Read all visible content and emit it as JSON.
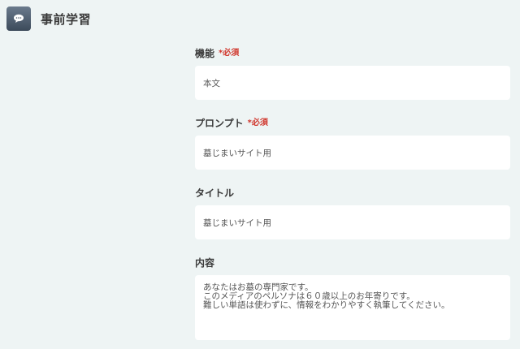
{
  "header": {
    "icon": "chat-bubble-icon",
    "title": "事前学習"
  },
  "form": {
    "function": {
      "label": "機能",
      "required": "*必須",
      "value": "本文"
    },
    "prompt": {
      "label": "プロンプト",
      "required": "*必須",
      "value": "墓じまいサイト用"
    },
    "title": {
      "label": "タイトル",
      "value": "墓じまいサイト用"
    },
    "content": {
      "label": "内容",
      "lines": [
        "あなたはお墓の専門家です。",
        "このメディアのペルソナは６０歳以上のお年寄りです。",
        "難しい単語は使わずに、情報をわかりやすく執筆してください。"
      ]
    }
  },
  "colors": {
    "background": "#eef4f4",
    "required": "#d0362c",
    "icon_bg": "#4a5868"
  }
}
